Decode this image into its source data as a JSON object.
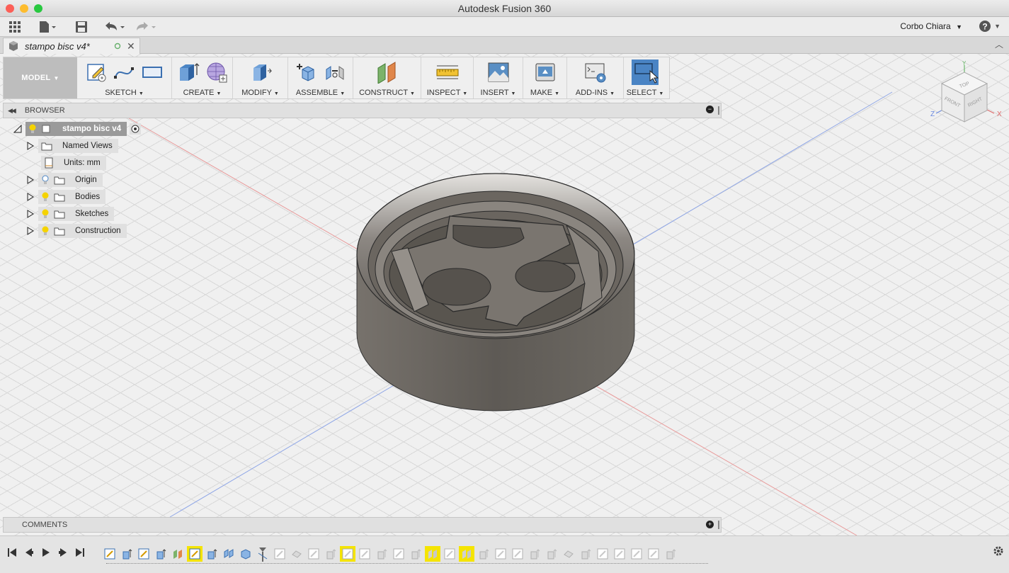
{
  "window": {
    "title": "Autodesk Fusion 360"
  },
  "user": {
    "name": "Corbo Chiara"
  },
  "document_tab": {
    "name": "stampo bisc v4*"
  },
  "toolbar": {
    "workspace": "MODEL",
    "groups": [
      {
        "label": "SKETCH"
      },
      {
        "label": "CREATE"
      },
      {
        "label": "MODIFY"
      },
      {
        "label": "ASSEMBLE"
      },
      {
        "label": "CONSTRUCT"
      },
      {
        "label": "INSPECT"
      },
      {
        "label": "INSERT"
      },
      {
        "label": "MAKE"
      },
      {
        "label": "ADD-INS"
      },
      {
        "label": "SELECT"
      }
    ]
  },
  "browser": {
    "title": "BROWSER",
    "root": "stampo bisc v4",
    "items": [
      {
        "label": "Named Views"
      },
      {
        "label": "Units: mm"
      },
      {
        "label": "Origin"
      },
      {
        "label": "Bodies"
      },
      {
        "label": "Sketches"
      },
      {
        "label": "Construction"
      }
    ]
  },
  "viewcube": {
    "top": "TOP",
    "front": "FRONT",
    "right": "RIGHT",
    "x": "X",
    "y": "Y",
    "z": "Z"
  },
  "comments": {
    "title": "COMMENTS"
  },
  "colors": {
    "accent": "#4a84c4",
    "highlight": "#f5e400",
    "body": "#5e5a55"
  }
}
